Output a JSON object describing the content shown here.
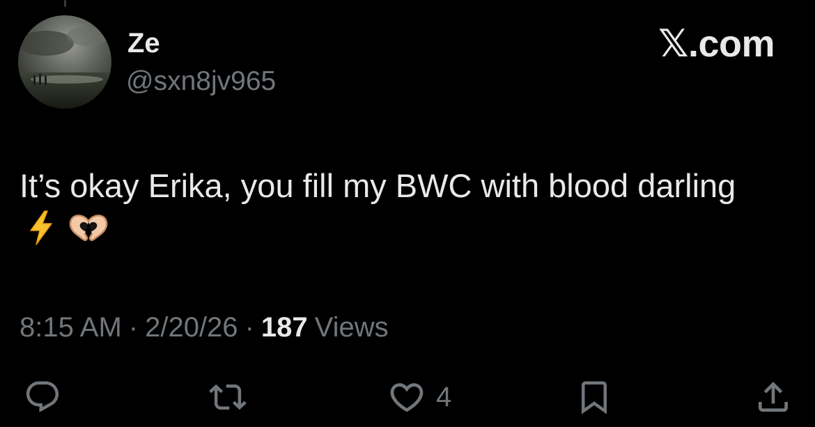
{
  "author": {
    "display_name": "Ze",
    "handle": "@sxn8jv965"
  },
  "brand": {
    "label": "𝕏.com"
  },
  "tweet": {
    "text": "It’s okay Erika, you fill my BWC with blood darling",
    "emojis": [
      "high-voltage-emoji",
      "heart-hands-emoji"
    ]
  },
  "meta": {
    "time": "8:15 AM",
    "date": "2/20/26",
    "separator": "·",
    "views_count": "187",
    "views_label": "Views"
  },
  "actions": {
    "reply_icon": "reply-icon",
    "retweet_icon": "retweet-icon",
    "like_icon": "heart-icon",
    "like_count": "4",
    "bookmark_icon": "bookmark-icon",
    "share_icon": "share-icon"
  },
  "colors": {
    "background": "#000000",
    "primary_text": "#e7e9ea",
    "secondary_text": "#71767b"
  }
}
